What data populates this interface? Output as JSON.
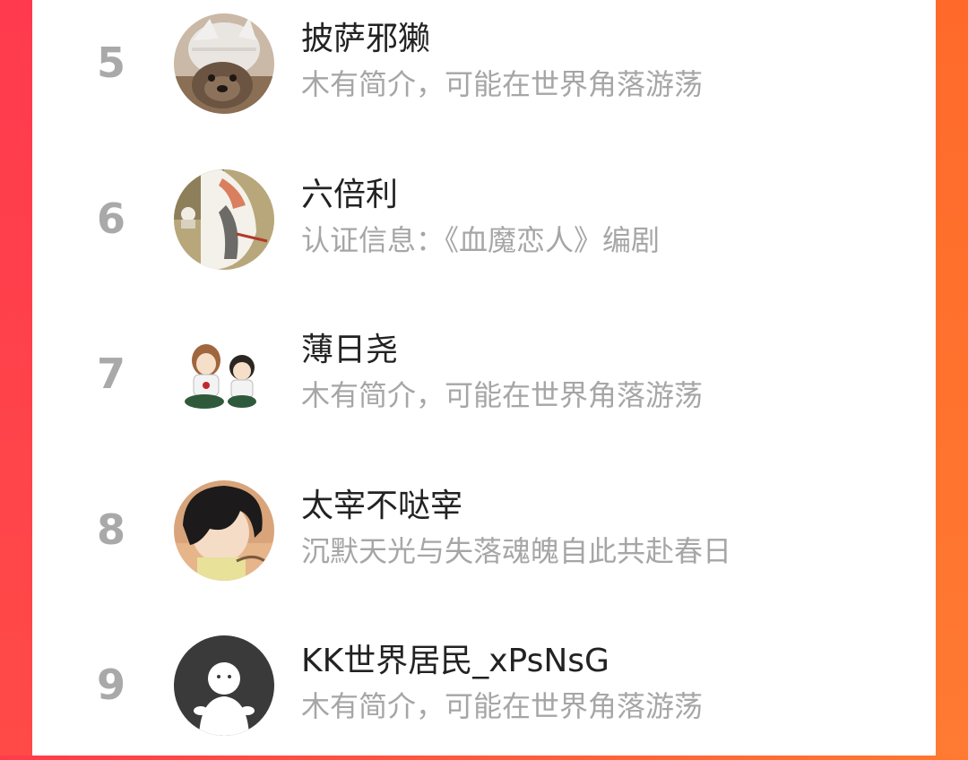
{
  "users": [
    {
      "rank": "5",
      "name": "披萨邪獭",
      "description": "木有简介，可能在世界角落游荡",
      "avatar_icon": "otter-avatar-icon"
    },
    {
      "rank": "6",
      "name": "六倍利",
      "description": "认证信息：《血魔恋人》编剧",
      "avatar_icon": "cartoon-cat-avatar-icon"
    },
    {
      "rank": "7",
      "name": "薄日尧",
      "description": "木有简介，可能在世界角落游荡",
      "avatar_icon": "two-characters-avatar-icon"
    },
    {
      "rank": "8",
      "name": "太宰不哒宰",
      "description": "沉默天光与失落魂魄自此共赴春日",
      "avatar_icon": "dark-hair-boy-avatar-icon"
    },
    {
      "rank": "9",
      "name": "KK世界居民_xPsNsG",
      "description": "木有简介，可能在世界角落游荡",
      "avatar_icon": "default-user-avatar-icon"
    }
  ],
  "colors": {
    "frame_left": "#ff3a4e",
    "frame_right": "#ff7a32",
    "rank_gray": "#a9a9a9",
    "name_text": "#222222",
    "desc_text": "#a6a6a6"
  }
}
